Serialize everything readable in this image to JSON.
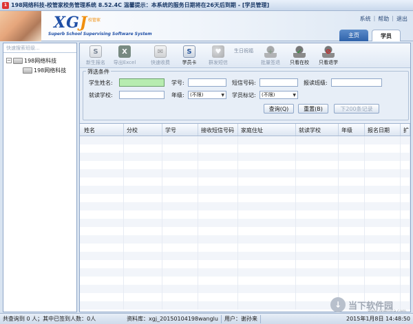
{
  "window": {
    "title": "198网络科技-校管家校务管理系统 8.52.4C  温馨提示：本系统的服务日期将在26天后到期 - [学员管理]"
  },
  "banner": {
    "logo_mark": "XG",
    "logo_mark_accent": "J",
    "logo_cn": "校管家",
    "logo_sub": "Superb School Supervising Software System",
    "toplinks": [
      "系统",
      "帮助",
      "退出"
    ],
    "tabs": [
      "主页",
      "学员"
    ]
  },
  "sidebar": {
    "search_placeholder": "快速搜索班级...",
    "tree": {
      "root": "198网络科技",
      "child": "198网络科技"
    }
  },
  "toolbar": {
    "buttons": [
      {
        "label": "新生报名",
        "icon": "student-card-icon",
        "enabled": false
      },
      {
        "label": "导出Excel",
        "icon": "excel-icon",
        "enabled": false
      },
      {
        "label": "快速收费",
        "icon": "envelope-icon",
        "enabled": false
      },
      {
        "label": "学员卡",
        "icon": "student-card-icon",
        "enabled": true
      },
      {
        "label": "群发短信",
        "icon": "heart-icon",
        "enabled": false
      },
      {
        "label": "批量签退",
        "icon": "user-add-icon",
        "enabled": false
      },
      {
        "label": "只看在校",
        "icon": "user-check-icon",
        "enabled": true
      },
      {
        "label": "只看退学",
        "icon": "user-block-icon",
        "enabled": true
      }
    ],
    "birthday_label": "生日祝福"
  },
  "filter": {
    "legend": "筛选条件",
    "name_label": "学生姓名:",
    "id_label": "学号:",
    "sms_label": "短信号码:",
    "class_label": "报读班级:",
    "school_label": "就读学校:",
    "grade_label": "年级:",
    "grade_value": "(不限)",
    "mark_label": "学员标记:",
    "mark_value": "(不限)",
    "query_button": "查询(Q)",
    "reset_button": "重置(B)",
    "next_button": "下200条记录"
  },
  "grid": {
    "columns": [
      "姓名",
      "分校",
      "学号",
      "接收短信号码",
      "家庭住址",
      "就读学校",
      "年级",
      "报名日期",
      "扩"
    ]
  },
  "status": {
    "query_summary": "共查询到 0 人；其中已签到人数：0人",
    "database": "资料库：xgj_20150104198wanglu",
    "user": "用户：谢孙来",
    "datetime": "2015年1月8日  14:48:50"
  },
  "watermark": {
    "text": "当下软件园",
    "url": "www.downxia.com"
  }
}
